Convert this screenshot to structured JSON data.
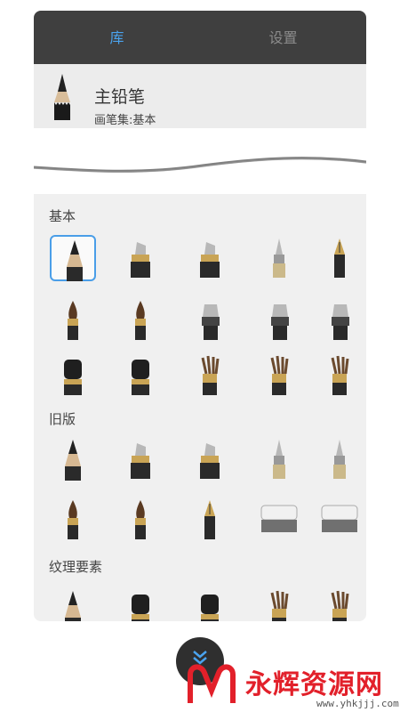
{
  "tabs": {
    "library": "库",
    "settings": "设置"
  },
  "current_brush": {
    "name": "主铅笔",
    "set": "画笔集:基本"
  },
  "sections": [
    {
      "title": "基本",
      "tools": [
        "pencil-icon",
        "wide-marker-icon",
        "chisel-marker-icon",
        "ballpoint-pen-icon",
        "fountain-pen-icon",
        "round-paintbrush-icon",
        "dark-paintbrush-icon",
        "airbrush-icon",
        "wide-airbrush-icon",
        "angled-airbrush-icon",
        "flat-stamp-brush-icon",
        "textured-brush-icon",
        "splayed-brush-icon",
        "bristle-brush-icon",
        "thick-bristle-brush-icon"
      ],
      "selected_index": 0
    },
    {
      "title": "旧版",
      "tools": [
        "legacy-pencil-icon",
        "legacy-marker-icon",
        "legacy-chisel-marker-icon",
        "legacy-felt-pen-icon",
        "legacy-ballpoint-icon",
        "legacy-paintbrush-icon",
        "legacy-fine-brush-icon",
        "legacy-nib-pen-icon",
        "legacy-eraser-icon",
        "legacy-soft-eraser-icon"
      ]
    },
    {
      "title": "纹理要素",
      "tools": [
        "texture-pencil-icon",
        "texture-charcoal-icon",
        "texture-stamp-icon",
        "texture-bristle-icon",
        "texture-splatter-icon"
      ]
    }
  ],
  "fab": {
    "icon": "chevron-down-icon"
  },
  "watermark": {
    "text": "永辉资源网",
    "url": "www.yhkjjj.com"
  }
}
